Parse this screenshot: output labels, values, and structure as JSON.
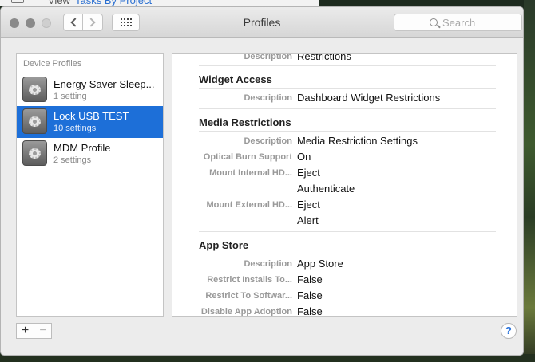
{
  "background": {
    "view_label": "View",
    "link_label": "Tasks By Project"
  },
  "window": {
    "title": "Profiles",
    "search": {
      "placeholder": "Search"
    }
  },
  "sidebar": {
    "header": "Device Profiles",
    "items": [
      {
        "name": "Energy Saver Sleep...",
        "sub": "1 setting",
        "selected": false
      },
      {
        "name": "Lock USB TEST",
        "sub": "10 settings",
        "selected": true
      },
      {
        "name": "MDM Profile",
        "sub": "2 settings",
        "selected": false
      }
    ]
  },
  "detail": {
    "top_row": {
      "key": "Description",
      "value": "Restrictions"
    },
    "widget_access": {
      "title": "Widget Access",
      "rows": [
        {
          "key": "Description",
          "value": "Dashboard Widget Restrictions"
        }
      ]
    },
    "media_restrictions": {
      "title": "Media Restrictions",
      "rows": [
        {
          "key": "Description",
          "value": "Media Restriction Settings"
        },
        {
          "key": "Optical Burn Support",
          "value": "On"
        },
        {
          "key": "Mount Internal HD...",
          "value": "Eject"
        },
        {
          "key": "",
          "value": "Authenticate"
        },
        {
          "key": "Mount External HD...",
          "value": "Eject"
        },
        {
          "key": "",
          "value": "Alert"
        }
      ]
    },
    "app_store": {
      "title": "App Store",
      "rows": [
        {
          "key": "Description",
          "value": "App Store"
        },
        {
          "key": "Restrict Installs To...",
          "value": "False"
        },
        {
          "key": "Restrict To Softwar...",
          "value": "False"
        },
        {
          "key": "Disable App Adoption",
          "value": "False"
        }
      ]
    }
  },
  "controls": {
    "add": "+",
    "remove": "−",
    "help": "?"
  },
  "colors": {
    "selection": "#1d6fd8",
    "help_accent": "#2a72d9"
  }
}
